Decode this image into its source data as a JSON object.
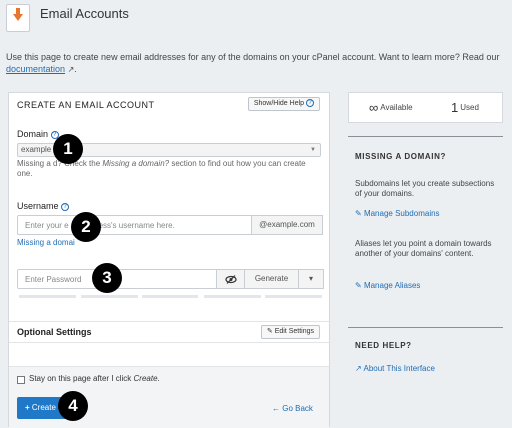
{
  "app": {
    "title": "Email Accounts",
    "icon": "envelope-download-icon"
  },
  "intro": {
    "text": "Use this page to create new email addresses for any of the domains on your cPanel account. Want to learn more? Read our ",
    "link": "documentation",
    "after": "."
  },
  "form": {
    "title": "CREATE AN EMAIL ACCOUNT",
    "help_toggle": "Show/Hide Help",
    "domain": {
      "label": "Domain",
      "value": "example",
      "hint_a": "Missing a d",
      "hint_b": "? Check the ",
      "hint_em": "Missing a domain?",
      "hint_c": " section to find out how you can create one."
    },
    "username": {
      "label": "Username",
      "placeholder_a": "Enter your e",
      "placeholder_b": "ess's username here.",
      "suffix": "@example.com",
      "link": "Missing a domai"
    },
    "password": {
      "placeholder": "Enter Password",
      "generate_label": "Generate"
    },
    "optional": {
      "title": "Optional Settings",
      "edit_label": "Edit Settings"
    },
    "stay": {
      "text": "Stay on this page after I click ",
      "em": "Create",
      "end": "."
    },
    "create_label": "Create",
    "go_back_label": "Go Back"
  },
  "markers": [
    "1",
    "2",
    "3",
    "4"
  ],
  "stats": {
    "available_value": "∞",
    "available_label": "Available",
    "used_value": "1",
    "used_label": "Used"
  },
  "sidebar": {
    "missing": {
      "title": "MISSING A DOMAIN?",
      "text1": "Subdomains let you create subsections of your domains.",
      "link1": "Manage Subdomains",
      "text2": "Aliases let you point a domain towards another of your domains' content.",
      "link2": "Manage Aliases"
    },
    "help": {
      "title": "NEED HELP?",
      "link": "About This Interface"
    }
  },
  "colors": {
    "accent": "#1f78c8",
    "link": "#1f6db5",
    "icon_orange": "#e8742e",
    "background": "#eceff2"
  }
}
